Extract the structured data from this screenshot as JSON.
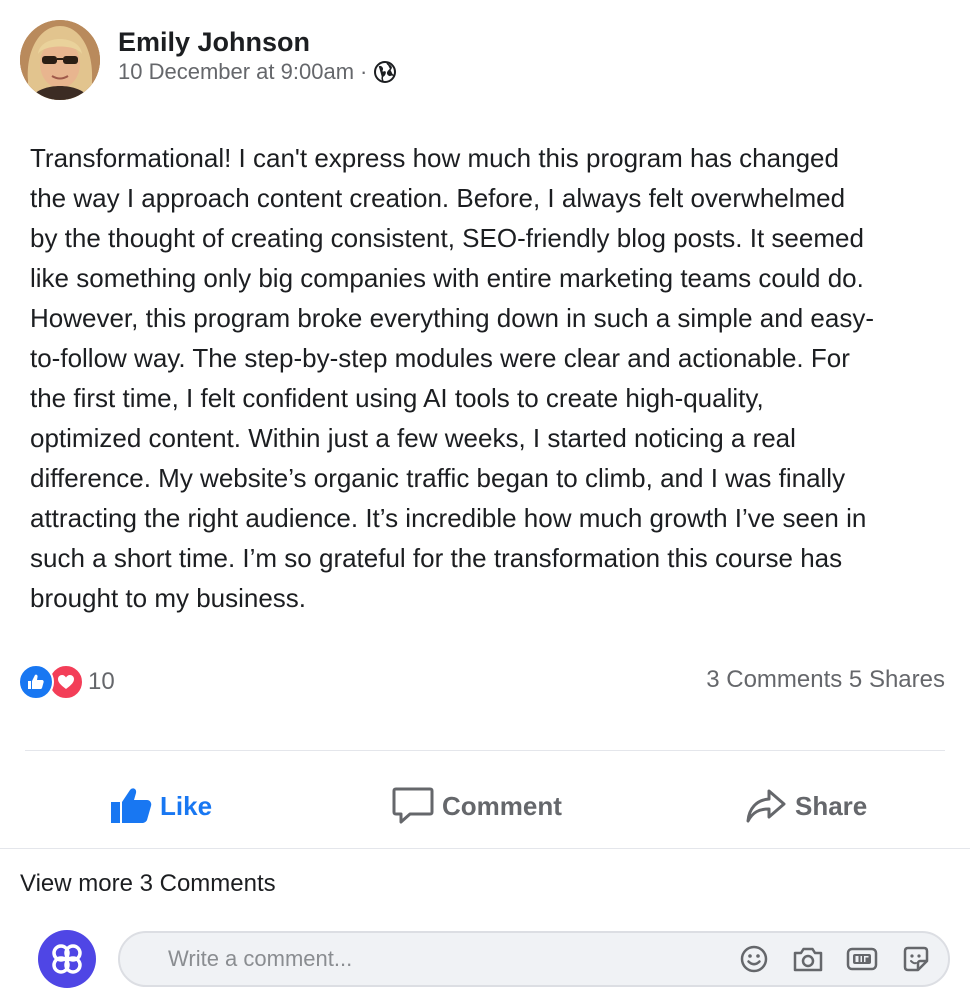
{
  "post": {
    "author": "Emily Johnson",
    "timestamp": "10 December at 9:00am",
    "separator": "·",
    "privacy_icon": "globe-icon",
    "body": "Transformational! I can't express how much this program has changed\nthe way I approach content creation. Before, I always felt overwhelmed\nby the thought of creating consistent, SEO-friendly blog posts. It seemed\nlike something only big companies with entire marketing teams could do.\nHowever, this program broke everything down in such a simple and easy-\nto-follow way. The step-by-step modules were clear and actionable. For\nthe first time, I felt confident using AI tools to create high-quality,\noptimized content. Within just a few weeks, I started noticing a real\ndifference. My website’s organic traffic began to climb, and I was finally\nattracting the right audience. It’s incredible how much growth I’ve seen in\nsuch a short time. I’m so grateful for the transformation this course has\nbrought to my business."
  },
  "reactions": {
    "icons": [
      "like-icon",
      "love-icon"
    ],
    "count": "10"
  },
  "stats": {
    "text": "3 Comments 5 Shares"
  },
  "actions": {
    "like": "Like",
    "comment": "Comment",
    "share": "Share"
  },
  "comments": {
    "view_more": "View more 3 Comments",
    "placeholder": "Write a comment...",
    "tools": [
      "emoji-icon",
      "camera-icon",
      "gif-icon",
      "sticker-icon"
    ]
  },
  "colors": {
    "accent": "#1877f2",
    "love": "#f33e58",
    "muted": "#65676b",
    "user_avatar": "#4f46e5"
  }
}
